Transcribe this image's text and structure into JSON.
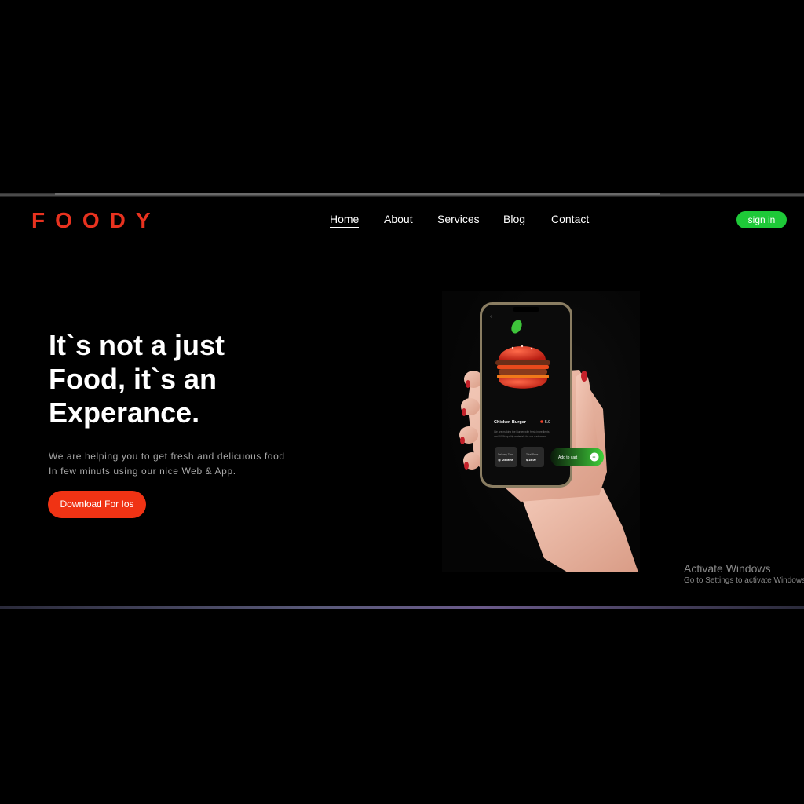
{
  "brand": {
    "logo": "FOODY",
    "accent": "#e8321f"
  },
  "nav": {
    "items": [
      {
        "label": "Home",
        "active": true
      },
      {
        "label": "About",
        "active": false
      },
      {
        "label": "Services",
        "active": false
      },
      {
        "label": "Blog",
        "active": false
      },
      {
        "label": "Contact",
        "active": false
      }
    ],
    "signin_label": "sign in",
    "signin_color": "#1ec938"
  },
  "hero": {
    "headline": [
      "It`s not a just",
      "Food, it`s an",
      "Experance."
    ],
    "subtext": [
      "We are helping you to get fresh and delicuous food",
      "In few minuts using our nice Web & App."
    ],
    "cta_label": "Download For Ios",
    "cta_color": "#f03314"
  },
  "app_preview": {
    "product_name": "Chicken Burger",
    "rating": "5.0",
    "description": [
      "We are making the Burger with fresh ingredients",
      "and 100% quality materials for our customers"
    ],
    "delivery_label": "Delivery Time",
    "delivery_value": "25 Mins",
    "price_label": "Total Price",
    "price_value": "$ 15.00",
    "add_label": "Add to cart",
    "icons": [
      "back-arrow-icon",
      "more-icon",
      "star-icon",
      "clock-icon",
      "plus-icon"
    ]
  },
  "os_watermark": {
    "title": "Activate Windows",
    "subtitle": "Go to Settings to activate Windows."
  }
}
